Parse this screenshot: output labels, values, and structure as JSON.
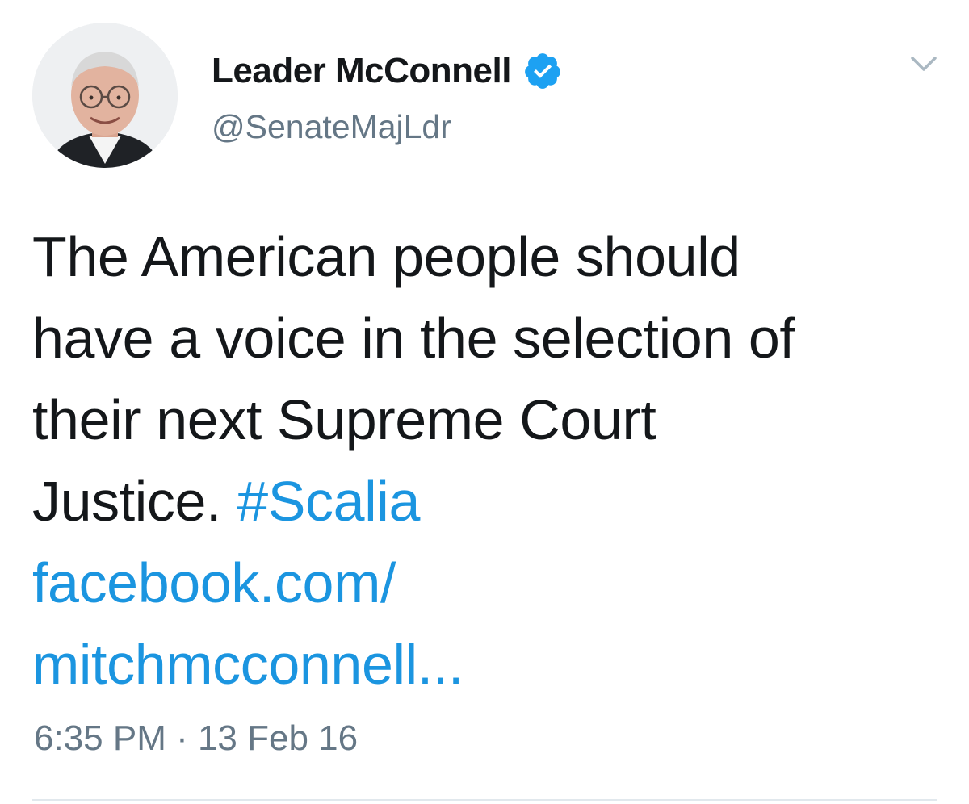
{
  "author": {
    "display_name": "Leader McConnell",
    "handle": "@SenateMajLdr",
    "verified": true,
    "verified_icon": "verified-badge-icon",
    "avatar_icon": "profile-photo"
  },
  "menu": {
    "icon": "chevron-down-icon"
  },
  "tweet": {
    "lines": [
      "The American people should",
      "have a voice in the selection of",
      "their next Supreme Court",
      "Justice."
    ],
    "hashtag": "#Scalia",
    "link_lines": [
      "facebook.com/",
      "mitchmcconnell..."
    ],
    "timestamp": "6:35 PM · 13 Feb 16"
  },
  "colors": {
    "text": "#14171a",
    "secondary": "#657786",
    "link": "#1b95e0",
    "verified": "#1da1f2",
    "divider": "#e1e8ed"
  }
}
